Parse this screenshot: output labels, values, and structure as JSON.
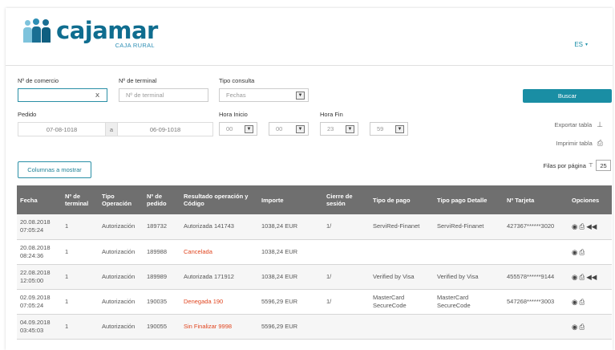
{
  "header": {
    "logo_word": "cajamar",
    "logo_sub": "CAJA RURAL",
    "language": "ES"
  },
  "filters": {
    "comercio_label": "Nº de comercio",
    "comercio_value": "X",
    "terminal_label": "Nº de terminal",
    "terminal_placeholder": "Nº de terminal",
    "tipo_label": "Tipo consulta",
    "tipo_value": "Fechas",
    "pedido_label": "Pedido",
    "date_from": "07-08-1018",
    "date_sep": "a",
    "date_to": "06-09-1018",
    "hora_inicio_label": "Hora Inicio",
    "hora_inicio_h": "00",
    "hora_inicio_m": "00",
    "hora_fin_label": "Hora Fin",
    "hora_fin_h": "23",
    "hora_fin_m": "59"
  },
  "actions": {
    "buscar": "Buscar",
    "exportar": "Exportar tabla",
    "imprimir": "Imprimir tabla",
    "columnas": "Columnas a mostrar",
    "filas_label": "Filas por página",
    "filas_value": "25"
  },
  "table": {
    "headers": {
      "fecha": "Fecha",
      "terminal": "Nº de terminal",
      "tipo": "Tipo Operación",
      "pedido": "Nº de pedido",
      "resultado": "Resultado operación y Código",
      "importe": "Importe",
      "cierre": "Cierre de sesión",
      "tipo_pago": "Tipo de pago",
      "tipo_pago_detalle": "Tipo pago Detalle",
      "tarjeta": "Nº Tarjeta",
      "opciones": "Opciones"
    },
    "rows": [
      {
        "fecha1": "20.08.2018",
        "fecha2": "07:05:24",
        "terminal": "1",
        "tipo": "Autorización",
        "pedido": "189732",
        "resultado": "Autorizada 141743",
        "importe": "1038,24 EUR",
        "cierre": "1/",
        "tipo_pago": "ServiRed-Finanet",
        "tipo_pago_detalle": "ServiRed-Finanet",
        "tarjeta": "427367******3020"
      },
      {
        "fecha1": "20.08.2018",
        "fecha2": "08:24:36",
        "terminal": "1",
        "tipo": "Autorización",
        "pedido": "189988",
        "resultado": "Cancelada",
        "importe": "1038,24 EUR",
        "cierre": "",
        "tipo_pago": "",
        "tipo_pago_detalle": "",
        "tarjeta": ""
      },
      {
        "fecha1": "22.08.2018",
        "fecha2": "12:05:00",
        "terminal": "1",
        "tipo": "Autorización",
        "pedido": "189989",
        "resultado": "Autorizada 171912",
        "importe": "1038,24 EUR",
        "cierre": "1/",
        "tipo_pago": "Verified by Visa",
        "tipo_pago_detalle": "Verified by Visa",
        "tarjeta": "455578******9144"
      },
      {
        "fecha1": "02.09.2018",
        "fecha2": "07:05:24",
        "terminal": "1",
        "tipo": "Autorización",
        "pedido": "190035",
        "resultado": "Denegada 190",
        "importe": "5596,29 EUR",
        "cierre": "1/",
        "tipo_pago": "MasterCard SecureCode",
        "tipo_pago_detalle": "MasterCard SecureCode",
        "tarjeta": "547268******3003"
      },
      {
        "fecha1": "04.09.2018",
        "fecha2": "03:45:03",
        "terminal": "1",
        "tipo": "Autorización",
        "pedido": "190055",
        "resultado": "Sin Finalizar 9998",
        "importe": "5596,29 EUR",
        "cierre": "",
        "tipo_pago": "",
        "tipo_pago_detalle": "",
        "tarjeta": ""
      }
    ]
  },
  "icons": {
    "view": "eye-icon",
    "print": "printer-icon",
    "refund": "rewind-icon",
    "export": "download-icon",
    "filter": "filter-icon",
    "caret": "chevron-down-icon"
  },
  "colors": {
    "brand": "#0f6d8f",
    "primary_button": "#1a8ea4",
    "table_header": "#6f6f6f",
    "error_text": "#e0451f"
  }
}
